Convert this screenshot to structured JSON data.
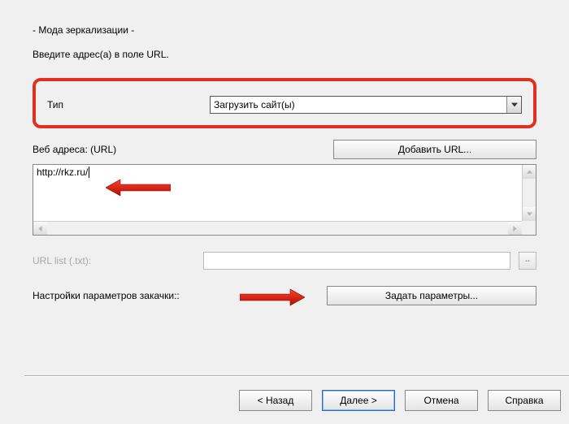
{
  "header": {
    "title": "- Мода зеркализации -",
    "instruction": "Введите адрес(а) в поле URL."
  },
  "type_section": {
    "label": "Тип",
    "selected": "Загрузить сайт(ы)"
  },
  "url_section": {
    "add_button": "Добавить URL...",
    "label": "Веб адреса: (URL)",
    "value": "http://rkz.ru/"
  },
  "url_list": {
    "label": "URL list (.txt):",
    "browse": ".."
  },
  "params": {
    "label": "Настройки параметров закачки::",
    "button": "Задать параметры..."
  },
  "footer": {
    "back": "< Назад",
    "next": "Далее >",
    "cancel": "Отмена",
    "help": "Справка"
  }
}
